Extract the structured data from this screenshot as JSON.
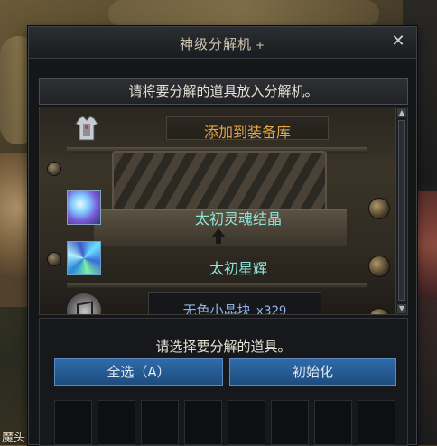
{
  "window": {
    "title": "神级分解机",
    "title_plus": "+",
    "close_glyph": "✕"
  },
  "instruction": "请将要分解的道具放入分解机。",
  "machine": {
    "add_to_storage": "添加到装备库",
    "items": [
      {
        "name": "太初灵魂结晶",
        "icon": "crystal-icon"
      },
      {
        "name": "太初星辉",
        "icon": "star-shard-icon"
      },
      {
        "name": "无色小晶块",
        "quantity": "x329",
        "icon": "colorless-cube-icon"
      }
    ]
  },
  "lower": {
    "prompt": "请选择要分解的道具。",
    "select_all_label": "全选（A）",
    "init_label": "初始化",
    "slot_count": 8
  },
  "background": {
    "bottom_left_text": "魔头"
  },
  "colors": {
    "add_label": "#e0a64a",
    "item_label": "#8ee4d8",
    "cube_label": "#8fb4e8",
    "button": "#2f6aa8"
  }
}
